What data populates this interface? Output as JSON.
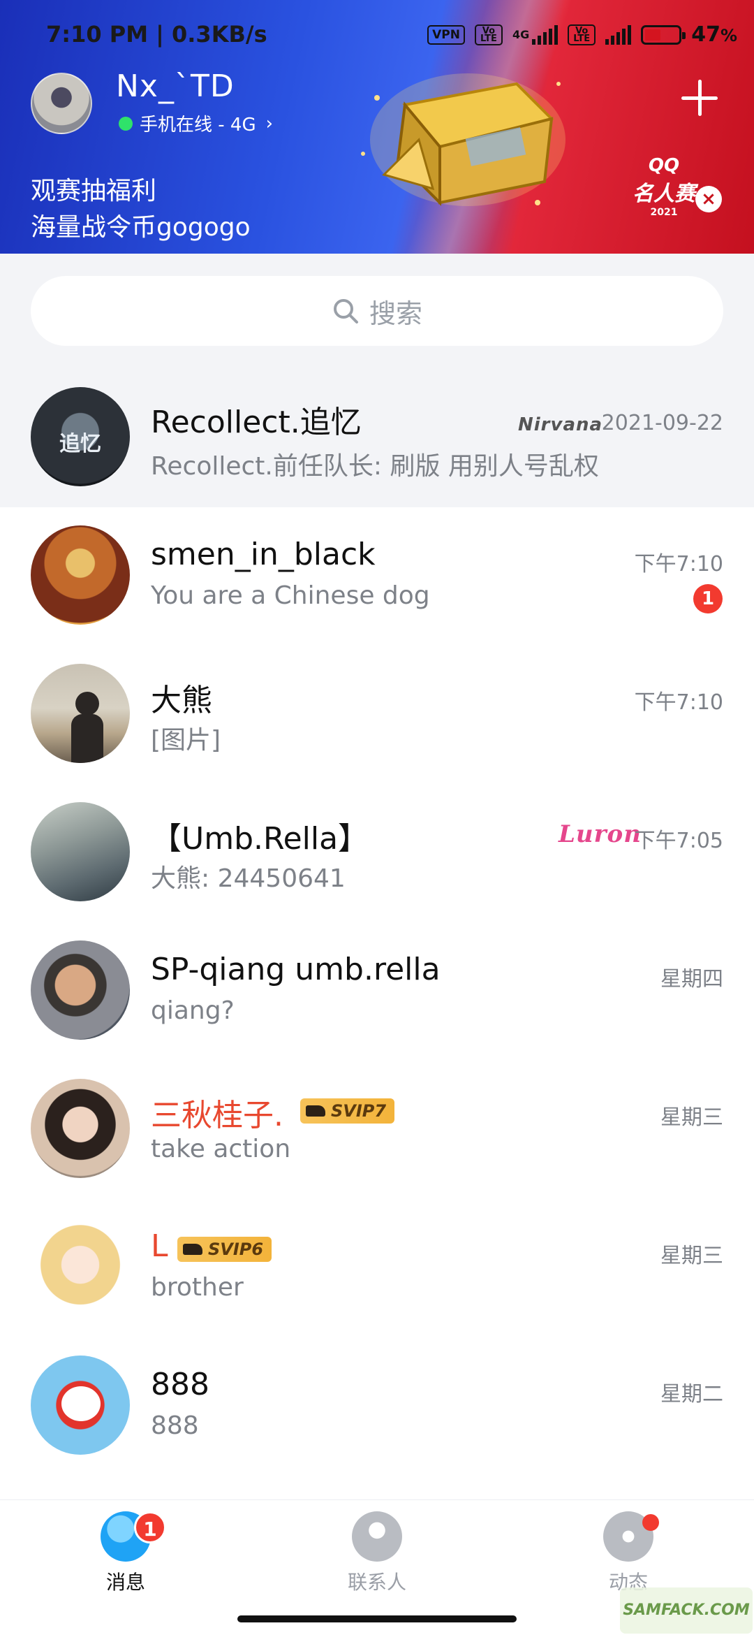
{
  "status_bar": {
    "time": "7:10 PM | 0.3KB/s",
    "vpn": "VPN",
    "volte1": "Vo LTE",
    "net": "4G",
    "volte2": "Vo LTE",
    "battery_pct": "47",
    "battery_symbol": "%"
  },
  "profile": {
    "name": "Nx_`TD",
    "status": "手机在线 - 4G",
    "chevron": "›",
    "status_color": "#2fe26a"
  },
  "banner": {
    "line1": "观赛抽福利",
    "line2": "海量战令币gogogo",
    "event_logo_l1": "QQ",
    "event_logo_l2": "名人赛",
    "event_logo_l3": "2021",
    "close": "×"
  },
  "search": {
    "placeholder": "搜索"
  },
  "chats": [
    {
      "name": "Recollect.追忆",
      "message": "Recollect.前任队长: 刷版  用别人号乱权",
      "time": "2021-09-22",
      "tag": "Nirvana",
      "pinned": true
    },
    {
      "name": "smen_in_black",
      "message": "You are a Chinese dog",
      "time": "下午7:10",
      "unread": "1"
    },
    {
      "name": "大熊",
      "message": "[图片]",
      "time": "下午7:10"
    },
    {
      "name": "【Umb.Rella】",
      "message": "大熊: 24450641",
      "time": "下午7:05",
      "tag": "Luron"
    },
    {
      "name": "SP-qiang umb.rella",
      "message": "qiang?",
      "time": "星期四"
    },
    {
      "name": "三秋桂子.",
      "message": "take action",
      "time": "星期三",
      "vip": "SVIP7"
    },
    {
      "name": "L",
      "message": "brother",
      "time": "星期三",
      "vip": "SVIP6"
    },
    {
      "name": "888",
      "message": "888",
      "time": "星期二"
    }
  ],
  "tabs": [
    {
      "label": "消息",
      "badge": "1",
      "active": true
    },
    {
      "label": "联系人"
    },
    {
      "label": "动态"
    }
  ],
  "watermark": "SAMFACK.COM",
  "colors": {
    "accent": "#1fa3f5",
    "badge": "#f23a2f",
    "vip_name": "#e8482f",
    "secondary_text": "#7d8188"
  }
}
